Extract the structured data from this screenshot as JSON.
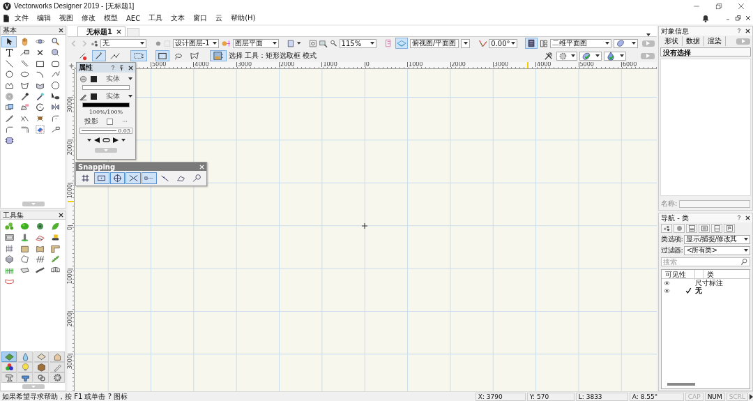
{
  "window": {
    "title": "Vectorworks Designer 2019 - [无标题1]"
  },
  "menu": [
    "文件",
    "编辑",
    "视图",
    "修改",
    "模型",
    "AEC",
    "工具",
    "文本",
    "窗口",
    "云",
    "帮助(H)"
  ],
  "palettes": [
    {
      "title": "基本",
      "tools": [
        {
          "kind": "pointer",
          "selected": true
        },
        {
          "kind": "pan",
          "selected": false
        },
        {
          "kind": "flyover",
          "selected": false
        },
        {
          "kind": "zoom",
          "selected": false
        },
        {
          "kind": "text",
          "selected": false
        },
        {
          "kind": "callout",
          "selected": false
        },
        {
          "kind": "locus",
          "selected": false
        },
        {
          "kind": "select3d",
          "selected": false
        },
        {
          "kind": "line",
          "selected": false
        },
        {
          "kind": "doubleline",
          "selected": false
        },
        {
          "kind": "rect",
          "selected": false
        },
        {
          "kind": "roundrect",
          "selected": false
        },
        {
          "kind": "circle",
          "selected": false
        },
        {
          "kind": "oval",
          "selected": false
        },
        {
          "kind": "arc",
          "selected": false
        },
        {
          "kind": "freehand",
          "selected": false
        },
        {
          "kind": "polyline",
          "selected": false
        },
        {
          "kind": "polygon",
          "selected": false
        },
        {
          "kind": "polygon3d",
          "selected": false
        },
        {
          "kind": "regpoly",
          "selected": false
        },
        {
          "kind": "spiral",
          "selected": false
        },
        {
          "kind": "eyedropper",
          "selected": false
        },
        {
          "kind": "wand",
          "selected": false
        },
        {
          "kind": "attribute",
          "selected": false
        },
        {
          "kind": "clip",
          "selected": false
        },
        {
          "kind": "reshape",
          "selected": false
        },
        {
          "kind": "rotate",
          "selected": false
        },
        {
          "kind": "mirror",
          "selected": false
        },
        {
          "kind": "split",
          "selected": false
        },
        {
          "kind": "connect",
          "selected": false
        },
        {
          "kind": "beetle",
          "selected": false
        },
        {
          "kind": "fillet",
          "selected": false
        },
        {
          "kind": "chamfer",
          "selected": false
        },
        {
          "kind": "corner",
          "selected": false
        },
        {
          "kind": "eraser",
          "selected": false
        },
        {
          "kind": "offset",
          "selected": false
        },
        {
          "kind": "capsule",
          "selected": false
        }
      ]
    },
    {
      "title": "工具集",
      "tools": [
        {
          "kind": "trees",
          "selected": false
        },
        {
          "kind": "shrub",
          "selected": false
        },
        {
          "kind": "plant",
          "selected": false
        },
        {
          "kind": "leaf",
          "selected": false
        },
        {
          "kind": "siteplan",
          "selected": false
        },
        {
          "kind": "post",
          "selected": false
        },
        {
          "kind": "road",
          "selected": false
        },
        {
          "kind": "bulldozer",
          "selected": false
        },
        {
          "kind": "railing",
          "selected": false
        },
        {
          "kind": "wall",
          "selected": false
        },
        {
          "kind": "curvedwall",
          "selected": false
        },
        {
          "kind": "cornerwall",
          "selected": false
        },
        {
          "kind": "pad",
          "selected": false
        },
        {
          "kind": "outline",
          "selected": false
        },
        {
          "kind": "hatch",
          "selected": false
        },
        {
          "kind": "hedge",
          "selected": false
        },
        {
          "kind": "fence",
          "selected": false
        },
        {
          "kind": "stair",
          "selected": false
        },
        {
          "kind": "spline",
          "selected": false
        },
        {
          "kind": "gridarc",
          "selected": false
        },
        {
          "kind": "curb",
          "selected": false
        }
      ],
      "sets": [
        {
          "kind": "landscape",
          "selected": true
        },
        {
          "kind": "water",
          "selected": false
        },
        {
          "kind": "plate",
          "selected": false
        },
        {
          "kind": "house",
          "selected": false
        },
        {
          "kind": "spheres",
          "selected": false
        },
        {
          "kind": "bulb",
          "selected": false
        },
        {
          "kind": "box",
          "selected": false
        },
        {
          "kind": "pencil",
          "selected": false
        },
        {
          "kind": "beam",
          "selected": false
        },
        {
          "kind": "pipe",
          "selected": false
        },
        {
          "kind": "chain",
          "selected": false
        },
        {
          "kind": "gear",
          "selected": false
        }
      ]
    }
  ],
  "document_tabs": [
    "无标题1"
  ],
  "view_bar": {
    "class": "无",
    "layer": "设计图层-1",
    "layer_plane": "图层平面",
    "zoom": "115%",
    "view": "俯视图/平面图",
    "angle": "0.00°",
    "render_mode": "二维平面图"
  },
  "tool_bar": {
    "modes": [
      {
        "kind": "remove",
        "selected": false
      },
      {
        "kind": "single",
        "selected": true
      },
      {
        "kind": "multi",
        "selected": false
      },
      {
        "kind": "options",
        "selected": true
      },
      {
        "kind": "rect",
        "selected": true
      },
      {
        "kind": "lasso",
        "selected": false
      },
      {
        "kind": "polylasso",
        "selected": false
      },
      {
        "kind": "save",
        "selected": true
      }
    ],
    "labels": [
      "选择",
      "工具：矩形选取框",
      "模式"
    ]
  },
  "rulers": {
    "horizontal": [
      "5000",
      "4000",
      "3000",
      "2000",
      "1000",
      "0",
      "1000",
      "2000",
      "3000",
      "4000",
      "5000",
      "6000"
    ],
    "vertical": [
      "3000",
      "2000",
      "1000",
      "0",
      "1000",
      "2000",
      "3000"
    ]
  },
  "attributes": {
    "title": "属性",
    "fill": "实体",
    "pen": "实体",
    "opacity": "100%/100%",
    "shadow_label": "投影",
    "shadow": false,
    "line_weight": "0.05"
  },
  "snapping": {
    "title": "Snapping",
    "buttons": [
      {
        "kind": "grid",
        "selected": false
      },
      {
        "kind": "object",
        "selected": true
      },
      {
        "kind": "angle",
        "selected": true
      },
      {
        "kind": "intersection",
        "selected": true
      },
      {
        "kind": "distance",
        "selected": true
      },
      {
        "kind": "edge",
        "selected": false
      },
      {
        "kind": "tangent",
        "selected": false
      },
      {
        "kind": "surface",
        "selected": false
      }
    ]
  },
  "object_info": {
    "title": "对象信息",
    "tabs": [
      "形状",
      "数据",
      "渲染"
    ],
    "selection": "没有选择",
    "name_label": "名称:"
  },
  "navigation": {
    "title": "导航 - 类",
    "class_options_label": "类选项:",
    "class_options": "显示/捕捉/修改其",
    "filter_label": "过滤器:",
    "filter": "<所有类>",
    "search_placeholder": "搜索",
    "columns": [
      "可见性",
      "类"
    ],
    "rows": [
      {
        "visible": true,
        "active": false,
        "name": "尺寸标注"
      },
      {
        "visible": true,
        "active": true,
        "name": "无"
      }
    ]
  },
  "status_bar": {
    "help": "如果希望寻求帮助，按 F1 或单击 ? 图标",
    "x": "X: 3790",
    "y": "Y: 570",
    "l": "L: 3833",
    "a": "A: 8.55°",
    "keys": [
      {
        "label": "CAP",
        "on": false
      },
      {
        "label": "NUM",
        "on": true
      },
      {
        "label": "SCRL",
        "on": false
      }
    ]
  }
}
